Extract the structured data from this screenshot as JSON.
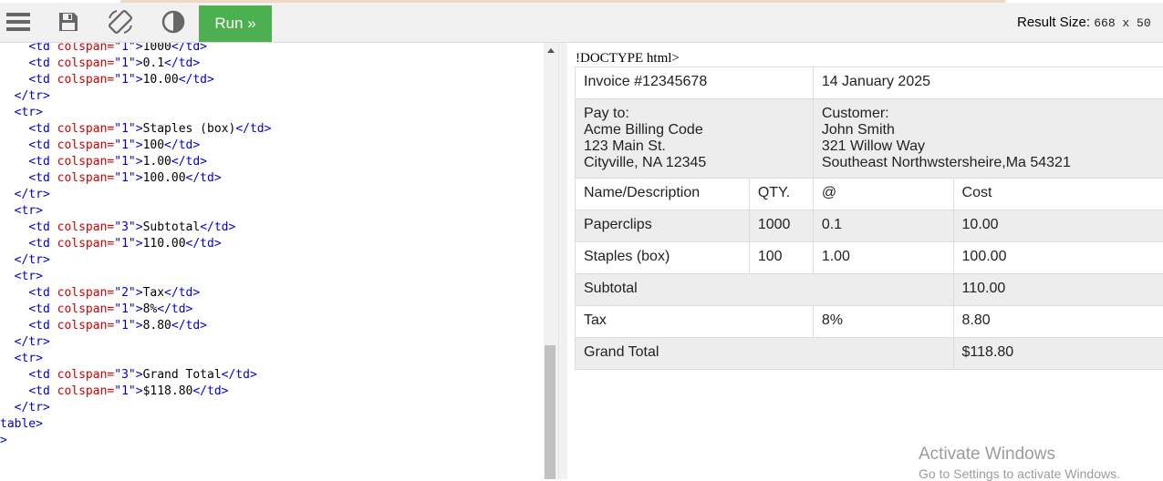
{
  "toolbar": {
    "run_label": "Run »",
    "result_size_label": "Result Size:",
    "result_size_value": "668 x 50"
  },
  "icons": [
    "menu-icon",
    "save-icon",
    "rotate-icon",
    "contrast-icon"
  ],
  "editor": {
    "lines": [
      [
        {
          "c": "tx",
          "t": "    "
        },
        {
          "c": "tg",
          "t": "<td "
        },
        {
          "c": "at",
          "t": "colspan="
        },
        {
          "c": "st",
          "t": "\"1\""
        },
        {
          "c": "tg",
          "t": ">"
        },
        {
          "c": "tx",
          "t": "1000"
        },
        {
          "c": "tg",
          "t": "</td>"
        }
      ],
      [
        {
          "c": "tx",
          "t": "    "
        },
        {
          "c": "tg",
          "t": "<td "
        },
        {
          "c": "at",
          "t": "colspan="
        },
        {
          "c": "st",
          "t": "\"1\""
        },
        {
          "c": "tg",
          "t": ">"
        },
        {
          "c": "tx",
          "t": "0.1"
        },
        {
          "c": "tg",
          "t": "</td>"
        }
      ],
      [
        {
          "c": "tx",
          "t": "    "
        },
        {
          "c": "tg",
          "t": "<td "
        },
        {
          "c": "at",
          "t": "colspan="
        },
        {
          "c": "st",
          "t": "\"1\""
        },
        {
          "c": "tg",
          "t": ">"
        },
        {
          "c": "tx",
          "t": "10.00"
        },
        {
          "c": "tg",
          "t": "</td>"
        }
      ],
      [
        {
          "c": "tx",
          "t": "  "
        },
        {
          "c": "tg",
          "t": "</tr>"
        }
      ],
      [
        {
          "c": "tx",
          "t": "  "
        },
        {
          "c": "tg",
          "t": "<tr>"
        }
      ],
      [
        {
          "c": "tx",
          "t": "    "
        },
        {
          "c": "tg",
          "t": "<td "
        },
        {
          "c": "at",
          "t": "colspan="
        },
        {
          "c": "st",
          "t": "\"1\""
        },
        {
          "c": "tg",
          "t": ">"
        },
        {
          "c": "tx",
          "t": "Staples (box)"
        },
        {
          "c": "tg",
          "t": "</td>"
        }
      ],
      [
        {
          "c": "tx",
          "t": "    "
        },
        {
          "c": "tg",
          "t": "<td "
        },
        {
          "c": "at",
          "t": "colspan="
        },
        {
          "c": "st",
          "t": "\"1\""
        },
        {
          "c": "tg",
          "t": ">"
        },
        {
          "c": "tx",
          "t": "100"
        },
        {
          "c": "tg",
          "t": "</td>"
        }
      ],
      [
        {
          "c": "tx",
          "t": "    "
        },
        {
          "c": "tg",
          "t": "<td "
        },
        {
          "c": "at",
          "t": "colspan="
        },
        {
          "c": "st",
          "t": "\"1\""
        },
        {
          "c": "tg",
          "t": ">"
        },
        {
          "c": "tx",
          "t": "1.00"
        },
        {
          "c": "tg",
          "t": "</td>"
        }
      ],
      [
        {
          "c": "tx",
          "t": "    "
        },
        {
          "c": "tg",
          "t": "<td "
        },
        {
          "c": "at",
          "t": "colspan="
        },
        {
          "c": "st",
          "t": "\"1\""
        },
        {
          "c": "tg",
          "t": ">"
        },
        {
          "c": "tx",
          "t": "100.00"
        },
        {
          "c": "tg",
          "t": "</td>"
        }
      ],
      [
        {
          "c": "tx",
          "t": "  "
        },
        {
          "c": "tg",
          "t": "</tr>"
        }
      ],
      [
        {
          "c": "tx",
          "t": "  "
        },
        {
          "c": "tg",
          "t": "<tr>"
        }
      ],
      [
        {
          "c": "tx",
          "t": "    "
        },
        {
          "c": "tg",
          "t": "<td "
        },
        {
          "c": "at",
          "t": "colspan="
        },
        {
          "c": "st",
          "t": "\"3\""
        },
        {
          "c": "tg",
          "t": ">"
        },
        {
          "c": "tx",
          "t": "Subtotal"
        },
        {
          "c": "tg",
          "t": "</td>"
        }
      ],
      [
        {
          "c": "tx",
          "t": "    "
        },
        {
          "c": "tg",
          "t": "<td "
        },
        {
          "c": "at",
          "t": "colspan="
        },
        {
          "c": "st",
          "t": "\"1\""
        },
        {
          "c": "tg",
          "t": ">"
        },
        {
          "c": "tx",
          "t": "110.00"
        },
        {
          "c": "tg",
          "t": "</td>"
        }
      ],
      [
        {
          "c": "tx",
          "t": "  "
        },
        {
          "c": "tg",
          "t": "</tr>"
        }
      ],
      [
        {
          "c": "tx",
          "t": "  "
        },
        {
          "c": "tg",
          "t": "<tr>"
        }
      ],
      [
        {
          "c": "tx",
          "t": "    "
        },
        {
          "c": "tg",
          "t": "<td "
        },
        {
          "c": "at",
          "t": "colspan="
        },
        {
          "c": "st",
          "t": "\"2\""
        },
        {
          "c": "tg",
          "t": ">"
        },
        {
          "c": "tx",
          "t": "Tax"
        },
        {
          "c": "tg",
          "t": "</td>"
        }
      ],
      [
        {
          "c": "tx",
          "t": "    "
        },
        {
          "c": "tg",
          "t": "<td "
        },
        {
          "c": "at",
          "t": "colspan="
        },
        {
          "c": "st",
          "t": "\"1\""
        },
        {
          "c": "tg",
          "t": ">"
        },
        {
          "c": "tx",
          "t": "8%"
        },
        {
          "c": "tg",
          "t": "</td>"
        }
      ],
      [
        {
          "c": "tx",
          "t": "    "
        },
        {
          "c": "tg",
          "t": "<td "
        },
        {
          "c": "at",
          "t": "colspan="
        },
        {
          "c": "st",
          "t": "\"1\""
        },
        {
          "c": "tg",
          "t": ">"
        },
        {
          "c": "tx",
          "t": "8.80"
        },
        {
          "c": "tg",
          "t": "</td>"
        }
      ],
      [
        {
          "c": "tx",
          "t": "  "
        },
        {
          "c": "tg",
          "t": "</tr>"
        }
      ],
      [
        {
          "c": "tx",
          "t": "  "
        },
        {
          "c": "tg",
          "t": "<tr>"
        }
      ],
      [
        {
          "c": "tx",
          "t": "    "
        },
        {
          "c": "tg",
          "t": "<td "
        },
        {
          "c": "at",
          "t": "colspan="
        },
        {
          "c": "st",
          "t": "\"3\""
        },
        {
          "c": "tg",
          "t": ">"
        },
        {
          "c": "tx",
          "t": "Grand Total"
        },
        {
          "c": "tg",
          "t": "</td>"
        }
      ],
      [
        {
          "c": "tx",
          "t": "    "
        },
        {
          "c": "tg",
          "t": "<td "
        },
        {
          "c": "at",
          "t": "colspan="
        },
        {
          "c": "st",
          "t": "\"1\""
        },
        {
          "c": "tg",
          "t": ">"
        },
        {
          "c": "tx",
          "t": "$118.80"
        },
        {
          "c": "tg",
          "t": "</td>"
        }
      ],
      [
        {
          "c": "tx",
          "t": "  "
        },
        {
          "c": "tg",
          "t": "</tr>"
        }
      ],
      [
        {
          "c": "tg",
          "t": "table>"
        }
      ],
      [
        {
          "c": "tg",
          "t": ">"
        }
      ]
    ]
  },
  "result": {
    "doctype_text": "!DOCTYPE html>",
    "invoice_number": "Invoice #12345678",
    "invoice_date": "14 January 2025",
    "pay_to": [
      "Pay to:",
      "Acme Billing Code",
      "123 Main St.",
      "Cityville, NA 12345"
    ],
    "customer": [
      "Customer:",
      "John Smith",
      "321 Willow Way",
      "Southeast Northwstersheire,Ma 54321"
    ],
    "headers": [
      "Name/Description",
      "QTY.",
      "@",
      "Cost"
    ],
    "items": [
      [
        "Paperclips",
        "1000",
        "0.1",
        "10.00"
      ],
      [
        "Staples (box)",
        "100",
        "1.00",
        "100.00"
      ]
    ],
    "subtotal_label": "Subtotal",
    "subtotal_value": "110.00",
    "tax_label": "Tax",
    "tax_rate": "8%",
    "tax_value": "8.80",
    "grand_total_label": "Grand Total",
    "grand_total_value": "$118.80"
  },
  "watermark": {
    "title": "Activate Windows",
    "subtitle": "Go to Settings to activate Windows."
  },
  "colors": {
    "run_button": "#4caf50",
    "code_tag": "#0000cd",
    "code_attr": "#cd0000"
  }
}
